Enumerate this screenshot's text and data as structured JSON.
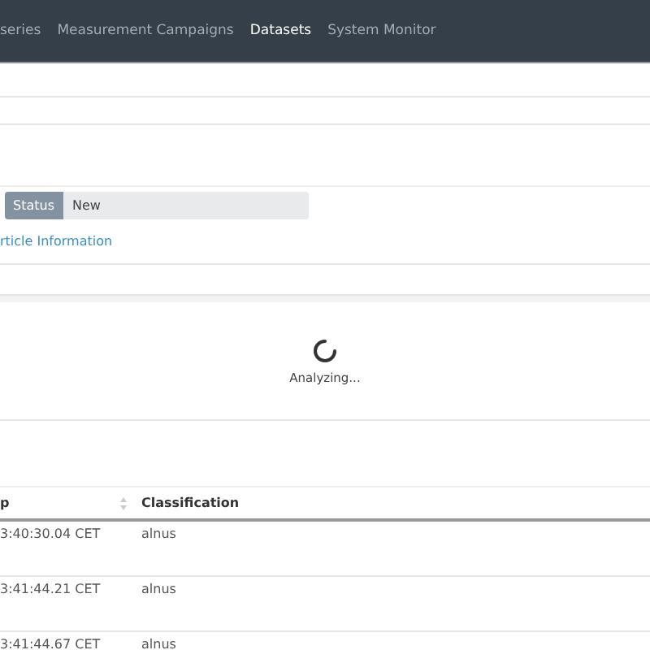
{
  "nav": {
    "items": [
      {
        "label": "series",
        "selected": false
      },
      {
        "label": "Measurement Campaigns",
        "selected": false
      },
      {
        "label": "Datasets",
        "selected": true
      },
      {
        "label": "System Monitor",
        "selected": false
      }
    ]
  },
  "status_field": {
    "label": "Status",
    "value": "New"
  },
  "link": "rticle Information",
  "loading": {
    "text": "Analyzing..."
  },
  "table": {
    "columns": [
      "p",
      "Classification"
    ],
    "rows": [
      [
        "3:40:30.04 CET",
        "alnus"
      ],
      [
        "3:41:44.21 CET",
        "alnus"
      ],
      [
        "3:41:44.67 CET",
        "alnus"
      ]
    ]
  }
}
